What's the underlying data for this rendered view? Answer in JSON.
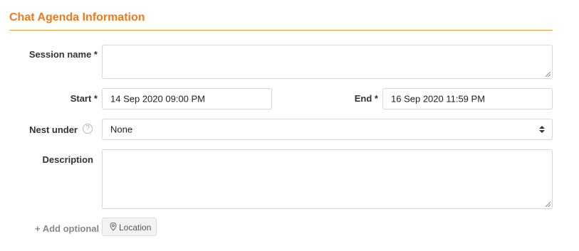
{
  "section": {
    "title": "Chat Agenda Information"
  },
  "session_name": {
    "label": "Session name *",
    "value": ""
  },
  "start": {
    "label": "Start *",
    "value": "14 Sep 2020 09:00 PM"
  },
  "end": {
    "label": "End *",
    "value": "16 Sep 2020 11:59 PM"
  },
  "nest_under": {
    "label": "Nest under",
    "help_icon": "?",
    "selected": "None"
  },
  "description": {
    "label": "Description",
    "value": ""
  },
  "optional": {
    "add_label": "+ Add optional",
    "location_label": "Location"
  },
  "colors": {
    "accent": "#f07a1a",
    "rule": "#e8a33a",
    "border": "#d7d7d7"
  },
  "icons": {
    "help": "question-circle-icon",
    "location": "map-pin-icon",
    "select": "select-arrows-icon",
    "resize": "resize-grip-icon"
  }
}
